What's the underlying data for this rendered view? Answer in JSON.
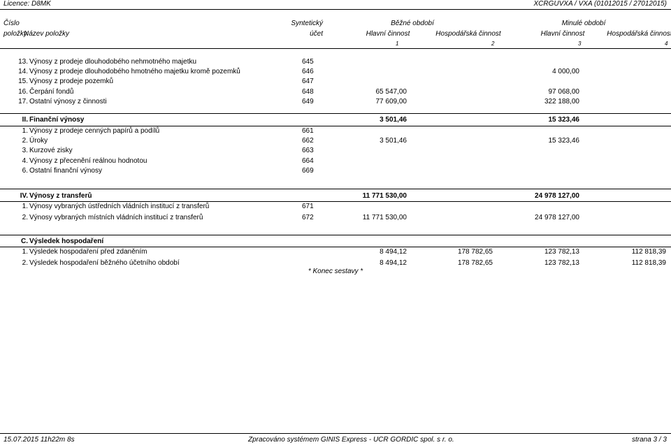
{
  "header": {
    "license": "Licence: D8MK",
    "report_code": "XCRGUVXA / VXA  (01012015 / 27012015)"
  },
  "columns": {
    "cislo": "Číslo",
    "polozky": "položky",
    "nazev": "Název položky",
    "synteticky": "Syntetický",
    "ucet": "účet",
    "bezne_obdobi": "Běžné období",
    "minule_obdobi": "Minulé období",
    "hlavni1": "Hlavní činnost",
    "hosp1": "Hospodářská činnost",
    "hlavni2": "Hlavní činnost",
    "hosp2": "Hospodářská činnost",
    "n1": "1",
    "n2": "2",
    "n3": "3",
    "n4": "4"
  },
  "rows_a": [
    {
      "num": "13.",
      "name": "Výnosy z prodeje dlouhodobého nehmotného majetku",
      "acct": "645",
      "v1": "",
      "v2": "",
      "v3": "",
      "v4": ""
    },
    {
      "num": "14.",
      "name": "Výnosy z prodeje dlouhodobého hmotného majetku kromě pozemků",
      "acct": "646",
      "v1": "",
      "v2": "",
      "v3": "4 000,00",
      "v4": ""
    },
    {
      "num": "15.",
      "name": "Výnosy z prodeje pozemků",
      "acct": "647",
      "v1": "",
      "v2": "",
      "v3": "",
      "v4": ""
    },
    {
      "num": "16.",
      "name": "Čerpání fondů",
      "acct": "648",
      "v1": "65 547,00",
      "v2": "",
      "v3": "97 068,00",
      "v4": ""
    },
    {
      "num": "17.",
      "name": "Ostatní výnosy z činnosti",
      "acct": "649",
      "v1": "77 609,00",
      "v2": "",
      "v3": "322 188,00",
      "v4": ""
    }
  ],
  "section_ii": {
    "num": "II.",
    "name": "Finanční výnosy",
    "v1": "3 501,46",
    "v3": "15 323,46"
  },
  "rows_ii": [
    {
      "num": "1.",
      "name": "Výnosy z prodeje cenných papírů a podílů",
      "acct": "661",
      "v1": "",
      "v2": "",
      "v3": "",
      "v4": ""
    },
    {
      "num": "2.",
      "name": "Úroky",
      "acct": "662",
      "v1": "3 501,46",
      "v2": "",
      "v3": "15 323,46",
      "v4": ""
    },
    {
      "num": "3.",
      "name": "Kurzové zisky",
      "acct": "663",
      "v1": "",
      "v2": "",
      "v3": "",
      "v4": ""
    },
    {
      "num": "4.",
      "name": "Výnosy z přecenění reálnou hodnotou",
      "acct": "664",
      "v1": "",
      "v2": "",
      "v3": "",
      "v4": ""
    },
    {
      "num": "6.",
      "name": "Ostatní finanční výnosy",
      "acct": "669",
      "v1": "",
      "v2": "",
      "v3": "",
      "v4": ""
    }
  ],
  "section_iv": {
    "num": "IV.",
    "name": "Výnosy z transferů",
    "v1": "11 771 530,00",
    "v3": "24 978 127,00"
  },
  "rows_iv": [
    {
      "num": "1.",
      "name": "Výnosy vybraných ústředních vládních institucí z transferů",
      "acct": "671",
      "v1": "",
      "v2": "",
      "v3": "",
      "v4": ""
    },
    {
      "num": "2.",
      "name": "Výnosy vybraných místních vládních institucí z transferů",
      "acct": "672",
      "v1": "11 771 530,00",
      "v2": "",
      "v3": "24 978 127,00",
      "v4": ""
    }
  ],
  "section_c": {
    "num": "C.",
    "name": "Výsledek hospodaření"
  },
  "rows_c": [
    {
      "num": "1.",
      "name": "Výsledek hospodaření před zdaněním",
      "acct": "",
      "v1": "8 494,12",
      "v2": "178 782,65",
      "v3": "123 782,13",
      "v4": "112 818,39"
    },
    {
      "num": "2.",
      "name": "Výsledek hospodaření běžného účetního období",
      "acct": "",
      "v1": "8 494,12",
      "v2": "178 782,65",
      "v3": "123 782,13",
      "v4": "112 818,39"
    }
  ],
  "end_note": "* Konec sestavy *",
  "footer": {
    "timestamp": "15.07.2015 11h22m 8s",
    "processed_by": "Zpracováno systémem GINIS Express - UCR GORDIC spol. s r. o.",
    "page": "strana 3 / 3"
  }
}
